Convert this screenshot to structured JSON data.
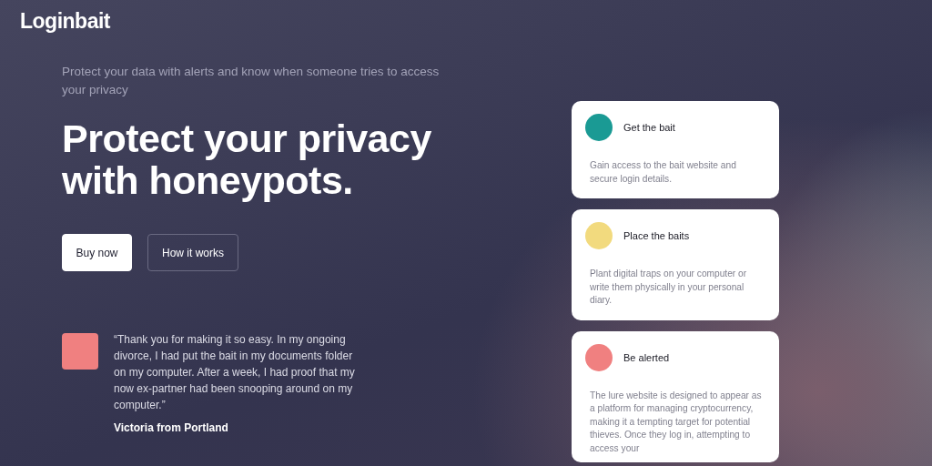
{
  "logo": "Loginbait",
  "hero": {
    "subtitle": "Protect your data with alerts and know when someone tries to access your privacy",
    "heading": "Protect your privacy with honeypots.",
    "buttons": [
      {
        "label": "Buy now",
        "kind": "primary"
      },
      {
        "label": "How it works",
        "kind": "outline"
      }
    ]
  },
  "testimonial": {
    "quote": "“Thank you for making it so easy. In my ongoing divorce, I had put the bait in my documents folder on my computer. After a week, I had proof that my now ex-partner had been snooping around on my computer.”",
    "author": "Victoria from Portland"
  },
  "steps": [
    {
      "title": "Get the bait",
      "color": "#1a9a94",
      "text": "Gain access to the bait website and secure login details."
    },
    {
      "title": "Place the baits",
      "color": "#f2da7e",
      "text": "Plant digital traps on your computer or write them physically in your personal diary."
    },
    {
      "title": "Be alerted",
      "color": "#f08080",
      "text": "The lure website is designed to appear as a platform for managing cryptocurrency, making it a tempting target for potential thieves. Once they log in, attempting to access your"
    }
  ]
}
